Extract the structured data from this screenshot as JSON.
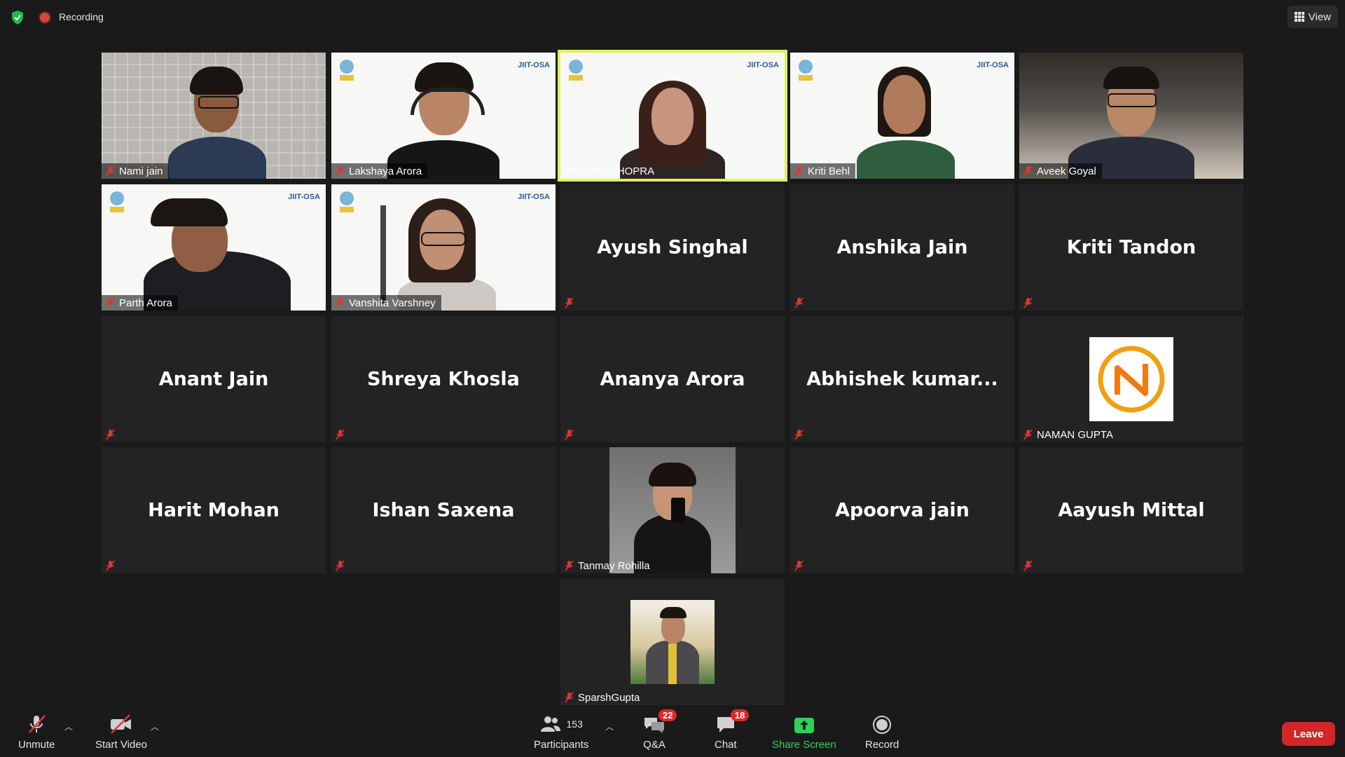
{
  "topbar": {
    "recording_label": "Recording",
    "view_label": "View"
  },
  "participants": [
    {
      "name": "Nami jain",
      "video": true
    },
    {
      "name": "Lakshaya Arora",
      "video": true
    },
    {
      "name": "ANANYA CHOPRA",
      "video": true,
      "active_speaker": true
    },
    {
      "name": "Kriti Behl",
      "video": true
    },
    {
      "name": "Aveek Goyal",
      "video": true
    },
    {
      "name": "Parth Arora",
      "video": true
    },
    {
      "name": "Vanshita Varshney",
      "video": true
    },
    {
      "name": "Ayush Singhal",
      "video": false
    },
    {
      "name": "Anshika Jain",
      "video": false
    },
    {
      "name": "Kriti Tandon",
      "video": false
    },
    {
      "name": "Anant Jain",
      "video": false
    },
    {
      "name": "Shreya Khosla",
      "video": false
    },
    {
      "name": "Ananya Arora",
      "video": false
    },
    {
      "name": "Abhishek  kumar...",
      "video": false
    },
    {
      "name": "NAMAN GUPTA",
      "video": false,
      "profile_picture": true
    },
    {
      "name": "Harit Mohan",
      "video": false
    },
    {
      "name": "Ishan Saxena",
      "video": false
    },
    {
      "name": "Tanmay Rohilla",
      "video": false,
      "profile_picture": true
    },
    {
      "name": "Apoorva jain",
      "video": false
    },
    {
      "name": "Aayush Mittal",
      "video": false
    },
    {
      "name": "SparshGupta",
      "video": false,
      "profile_picture": true
    }
  ],
  "overlay_logo": {
    "right_text": "JIIT-OSA"
  },
  "toolbar": {
    "unmute_label": "Unmute",
    "start_video_label": "Start Video",
    "participants_label": "Participants",
    "participants_count": "153",
    "qa_label": "Q&A",
    "qa_badge": "22",
    "chat_label": "Chat",
    "chat_badge": "18",
    "share_label": "Share Screen",
    "record_label": "Record",
    "leave_label": "Leave"
  },
  "colors": {
    "background": "#1a1a1a",
    "tile": "#232323",
    "active_border": "#dff061",
    "mute_red": "#e03535",
    "share_green": "#2fd15a",
    "leave_red": "#d12727"
  }
}
